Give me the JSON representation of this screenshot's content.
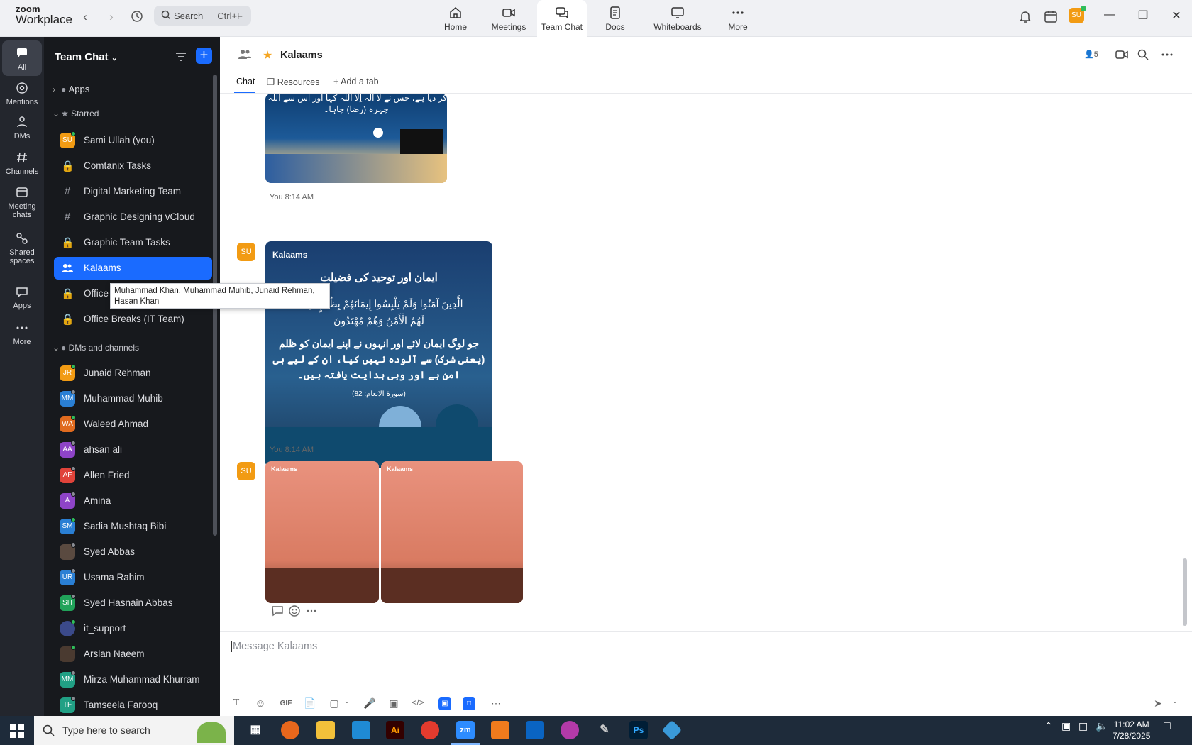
{
  "brand": {
    "line1": "zoom",
    "line2": "Workplace"
  },
  "search": {
    "placeholder": "Search",
    "shortcut": "Ctrl+F"
  },
  "topnav": [
    {
      "label": "Home",
      "icon": "home-icon"
    },
    {
      "label": "Meetings",
      "icon": "video-icon"
    },
    {
      "label": "Team Chat",
      "icon": "chat-icon",
      "active": true
    },
    {
      "label": "Docs",
      "icon": "docs-icon"
    },
    {
      "label": "Whiteboards",
      "icon": "whiteboard-icon"
    },
    {
      "label": "More",
      "icon": "more-icon"
    }
  ],
  "user_initials": "SU",
  "rail": [
    {
      "label": "All",
      "active": true
    },
    {
      "label": "Mentions"
    },
    {
      "label": "DMs"
    },
    {
      "label": "Channels"
    },
    {
      "label": "Meeting chats"
    },
    {
      "label": "Shared spaces"
    },
    {
      "label": "Apps"
    },
    {
      "label": "More"
    }
  ],
  "sidebar": {
    "title": "Team Chat",
    "apps_label": "Apps",
    "starred_label": "Starred",
    "starred": [
      {
        "name": "Sami Ullah (you)",
        "initials": "SU",
        "color": "#f29b13"
      },
      {
        "name": "Comtanix Tasks",
        "icon": "lock-icon"
      },
      {
        "name": "Digital Marketing Team",
        "icon": "hash-icon"
      },
      {
        "name": "Graphic Designing vCloud",
        "icon": "hash-icon"
      },
      {
        "name": "Graphic Team Tasks",
        "icon": "lock-icon"
      },
      {
        "name": "Kalaams",
        "icon": "group-icon",
        "active": true
      },
      {
        "name": "Office",
        "icon": "lock-icon"
      },
      {
        "name": "Office Breaks (IT Team)",
        "icon": "lock-icon"
      }
    ],
    "dms_label": "DMs and channels",
    "dms": [
      {
        "name": "Junaid Rehman",
        "initials": "JR",
        "color": "#f29b13"
      },
      {
        "name": "Muhammad Muhib",
        "initials": "MM",
        "color": "#2a7fd4"
      },
      {
        "name": "Waleed Ahmad",
        "initials": "WA",
        "color": "#e06b1f"
      },
      {
        "name": "ahsan ali",
        "initials": "AA",
        "color": "#8e44c7"
      },
      {
        "name": "Allen Fried",
        "initials": "AF",
        "color": "#e0433a"
      },
      {
        "name": "Amina",
        "initials": "A",
        "color": "#8e44c7"
      },
      {
        "name": "Sadia Mushtaq Bibi",
        "initials": "SM",
        "color": "#2a7fd4"
      },
      {
        "name": "Syed Abbas",
        "initials": "",
        "color": "#5a4a40"
      },
      {
        "name": "Usama Rahim",
        "initials": "UR",
        "color": "#2a7fd4"
      },
      {
        "name": "Syed Hasnain Abbas",
        "initials": "SH",
        "color": "#21a35a"
      },
      {
        "name": "it_support",
        "initials": "",
        "color": "#3b4a8a"
      },
      {
        "name": "Arslan Naeem",
        "initials": "",
        "color": "#4a3a30"
      },
      {
        "name": "Mirza Muhammad Khurram",
        "initials": "MM",
        "color": "#21a085"
      },
      {
        "name": "Tamseela Farooq",
        "initials": "TF",
        "color": "#21a085"
      }
    ]
  },
  "tooltip": "Muhammad Khan, Muhammad Muhib, Junaid Rehman, Hasan Khan",
  "chat": {
    "title": "Kalaams",
    "member_count": "5",
    "tabs": [
      "Chat",
      "Resources",
      "Add a tab"
    ],
    "messages": [
      {
        "sender": "SU",
        "time": "You 8:14 AM"
      },
      {
        "sender": "SU",
        "time": "You 8:14 AM"
      }
    ],
    "image1_text": [
      "کر دیا ہے، جس نے لا الہ اِلا اللّٰہ کہا اور اس سے اللّٰہ کا",
      "چہرہ (رضا) چاہا۔"
    ],
    "image2": {
      "brand": "Kalaams",
      "title": "ایمان اور توحید کی فضیلت",
      "arabic": [
        "الَّذِينَ آمَنُوا وَلَمْ يَلْبِسُوا إِيمَانَهُمْ بِظُلْمٍ أُولَٰئِكَ",
        "لَهُمُ الْأَمْنُ وَهُمْ مُهْتَدُونَ"
      ],
      "urdu": [
        "جو لوگ ایمان لائے اور انہوں نے اپنے ایمان کو ظلم",
        "(یعنی شرک) سے آلودہ نہیں کیا، ان کے لیے ہی",
        "امن ہے اور وہی ہدایت یافتہ ہیں۔"
      ],
      "ref": "(سورۃ الانعام: 82)"
    },
    "image3_brand": "Kalaams",
    "compose_placeholder": "Message Kalaams"
  },
  "taskbar": {
    "search_placeholder": "Type here to search",
    "time": "11:02 AM",
    "date": "7/28/2025"
  }
}
